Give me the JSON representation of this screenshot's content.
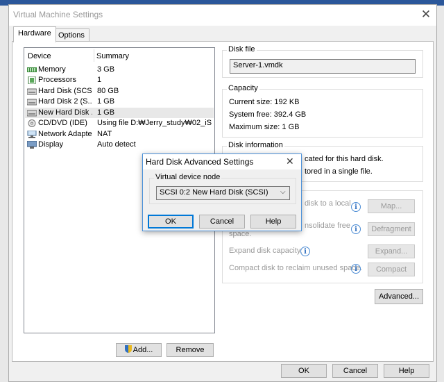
{
  "window": {
    "title": "Virtual Machine Settings",
    "close_glyph": "✕"
  },
  "tabs": [
    {
      "label": "Hardware",
      "active": true
    },
    {
      "label": "Options",
      "active": false
    }
  ],
  "device_list": {
    "headers": {
      "device": "Device",
      "summary": "Summary"
    },
    "rows": [
      {
        "device": "Memory",
        "summary": "3 GB",
        "icon": "memory-icon"
      },
      {
        "device": "Processors",
        "summary": "1",
        "icon": "processor-icon"
      },
      {
        "device": "Hard Disk (SCSI)",
        "summary": "80 GB",
        "icon": "hard-disk-icon"
      },
      {
        "device": "Hard Disk 2 (S...",
        "summary": "1 GB",
        "icon": "hard-disk-icon"
      },
      {
        "device": "New Hard Disk ...",
        "summary": "1 GB",
        "icon": "hard-disk-icon",
        "selected": true
      },
      {
        "device": "CD/DVD (IDE)",
        "summary": "Using file D:₩Jerry_study₩02_iS...",
        "icon": "cd-dvd-icon"
      },
      {
        "device": "Network Adapter",
        "summary": "NAT",
        "icon": "network-adapter-icon"
      },
      {
        "device": "Display",
        "summary": "Auto detect",
        "icon": "display-icon"
      }
    ],
    "add_label": "Add...",
    "remove_label": "Remove"
  },
  "disk_file": {
    "label": "Disk file",
    "value": "Server-1.vmdk"
  },
  "capacity": {
    "label": "Capacity",
    "current_size": "Current size:  192 KB",
    "system_free": "System free:  392.4 GB",
    "maximum_size": "Maximum size:  1 GB"
  },
  "disk_information": {
    "label": "Disk information",
    "line1": "cated for this hard disk.",
    "line2": "tored in a single file."
  },
  "utilities": {
    "map_text": "disk to a local",
    "map_button": "Map...",
    "defrag_text": "nsolidate free",
    "defrag_text2": "space.",
    "defrag_button": "Defragment",
    "expand_text": "Expand disk capacity.",
    "expand_button": "Expand...",
    "compact_text": "Compact disk to reclaim unused space.",
    "compact_button": "Compact"
  },
  "advanced_button": "Advanced...",
  "footer": {
    "ok": "OK",
    "cancel": "Cancel",
    "help": "Help"
  },
  "dialog": {
    "title": "Hard Disk Advanced Settings",
    "close_glyph": "✕",
    "group_label": "Virtual device node",
    "selected_node": "SCSI 0:2  New Hard Disk (SCSI)",
    "ok": "OK",
    "cancel": "Cancel",
    "help": "Help"
  },
  "colors": {
    "accent": "#0078d7",
    "selection": "#e8e8e8"
  }
}
